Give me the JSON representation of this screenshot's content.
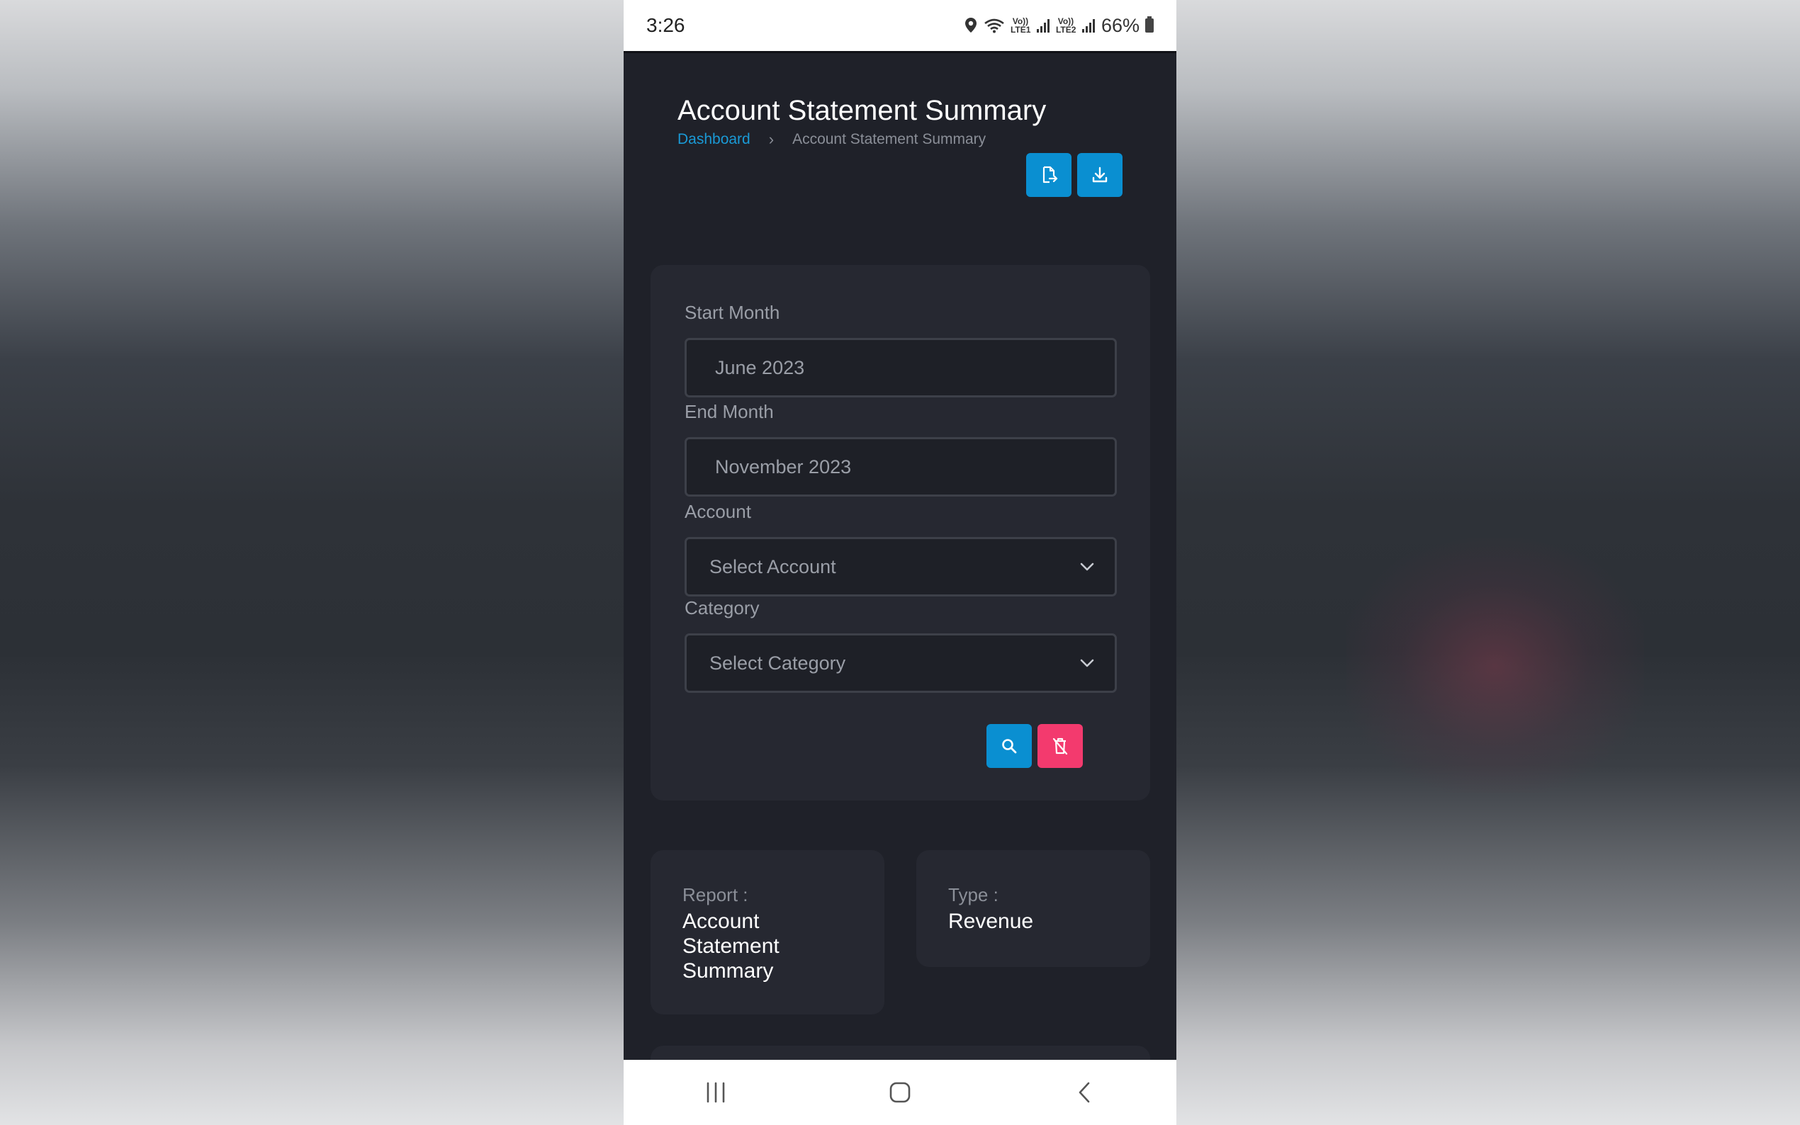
{
  "status_bar": {
    "time": "3:26",
    "signal_1": "Vo)) LTE1",
    "signal_2": "Vo)) LTE2",
    "battery": "66%"
  },
  "header": {
    "title": "Account Statement Summary",
    "breadcrumb": {
      "home": "Dashboard",
      "current": "Account Statement Summary"
    },
    "actions": {
      "export_icon": "file-export-icon",
      "download_icon": "download-icon"
    }
  },
  "filters": {
    "start_month": {
      "label": "Start Month",
      "value": "June 2023"
    },
    "end_month": {
      "label": "End Month",
      "value": "November 2023"
    },
    "account": {
      "label": "Account",
      "selected": "Select Account"
    },
    "category": {
      "label": "Category",
      "selected": "Select Category"
    },
    "actions": {
      "search_icon": "search-icon",
      "clear_icon": "clear-filter-icon"
    }
  },
  "report_info": {
    "report": {
      "label": "Report :",
      "value": "Account Statement Summary"
    },
    "type": {
      "label": "Type :",
      "value": "Revenue"
    }
  },
  "navigation": {
    "recent_icon": "recent-apps-icon",
    "home_icon": "home-icon",
    "back_icon": "back-icon"
  },
  "colors": {
    "primary": "#0a8fd1",
    "danger": "#f33a6e",
    "page_bg": "#1f2129",
    "card_bg": "#262831",
    "link": "#1a9ad6"
  }
}
